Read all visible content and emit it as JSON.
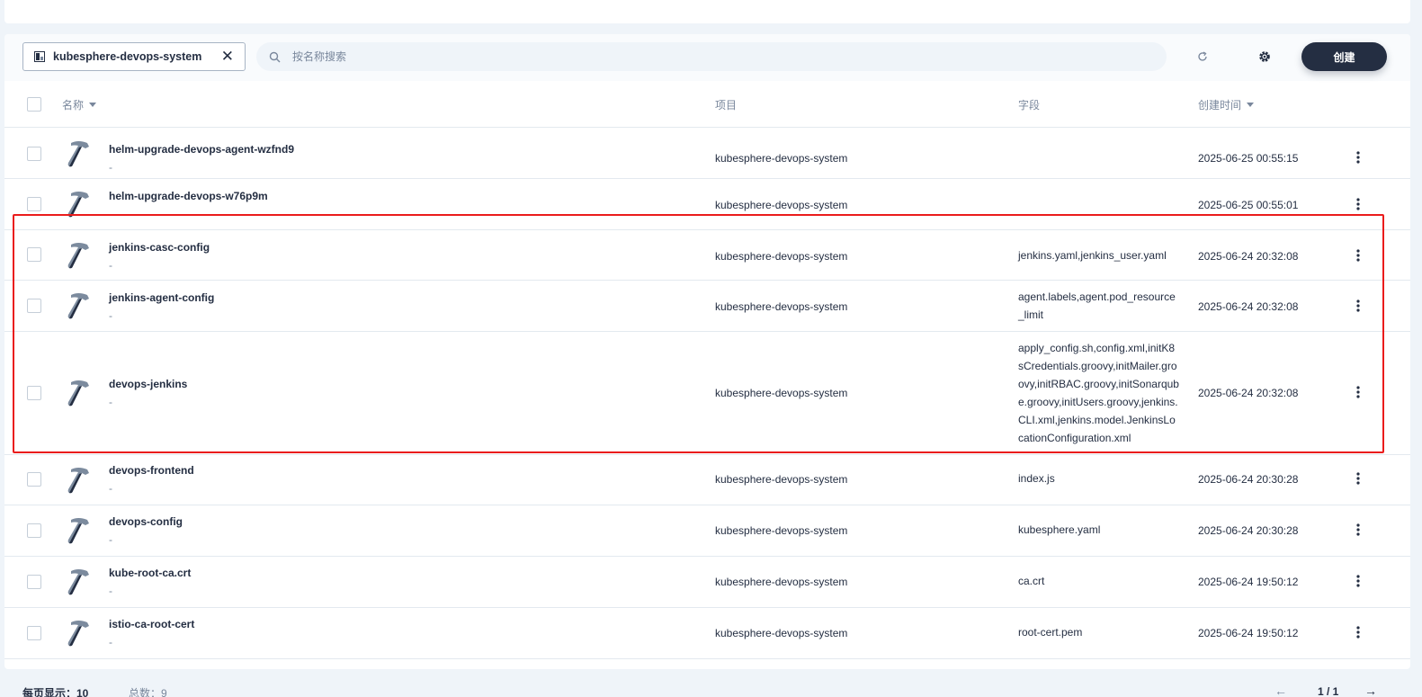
{
  "toolbar": {
    "namespace": "kubesphere-devops-system",
    "search_placeholder": "按名称搜索",
    "create_label": "创建"
  },
  "table": {
    "columns": {
      "name": "名称",
      "project": "项目",
      "fields": "字段",
      "created": "创建时间"
    },
    "rows": [
      {
        "name": "helm-upgrade-devops-agent-wzfnd9",
        "desc": "-",
        "project": "kubesphere-devops-system",
        "fields": "",
        "created": "2025-06-25 00:55:15"
      },
      {
        "name": "helm-upgrade-devops-w76p9m",
        "desc": "-",
        "project": "kubesphere-devops-system",
        "fields": "",
        "created": "2025-06-25 00:55:01"
      },
      {
        "name": "jenkins-casc-config",
        "desc": "-",
        "project": "kubesphere-devops-system",
        "fields": "jenkins.yaml,jenkins_user.yaml",
        "created": "2025-06-24 20:32:08"
      },
      {
        "name": "jenkins-agent-config",
        "desc": "-",
        "project": "kubesphere-devops-system",
        "fields": "agent.labels,agent.pod_resource_limit",
        "created": "2025-06-24 20:32:08"
      },
      {
        "name": "devops-jenkins",
        "desc": "-",
        "project": "kubesphere-devops-system",
        "fields": "apply_config.sh,config.xml,initK8sCredentials.groovy,initMailer.groovy,initRBAC.groovy,initSonarqube.groovy,initUsers.groovy,jenkins.CLI.xml,jenkins.model.JenkinsLocationConfiguration.xml",
        "created": "2025-06-24 20:32:08"
      },
      {
        "name": "devops-frontend",
        "desc": "-",
        "project": "kubesphere-devops-system",
        "fields": "index.js",
        "created": "2025-06-24 20:30:28"
      },
      {
        "name": "devops-config",
        "desc": "-",
        "project": "kubesphere-devops-system",
        "fields": "kubesphere.yaml",
        "created": "2025-06-24 20:30:28"
      },
      {
        "name": "kube-root-ca.crt",
        "desc": "-",
        "project": "kubesphere-devops-system",
        "fields": "ca.crt",
        "created": "2025-06-24 19:50:12"
      },
      {
        "name": "istio-ca-root-cert",
        "desc": "-",
        "project": "kubesphere-devops-system",
        "fields": "root-cert.pem",
        "created": "2025-06-24 19:50:12"
      }
    ]
  },
  "footer": {
    "per_page": "每页显示：10",
    "total": "总数：9",
    "pager": "1 / 1",
    "prev": "←",
    "next": "→"
  },
  "colors": {
    "highlight": "#ea1c1c",
    "primary": "#242e42",
    "muted": "#79879c"
  },
  "icons": {
    "row_icon": "hammer-icon",
    "namespace": "project-icon"
  }
}
